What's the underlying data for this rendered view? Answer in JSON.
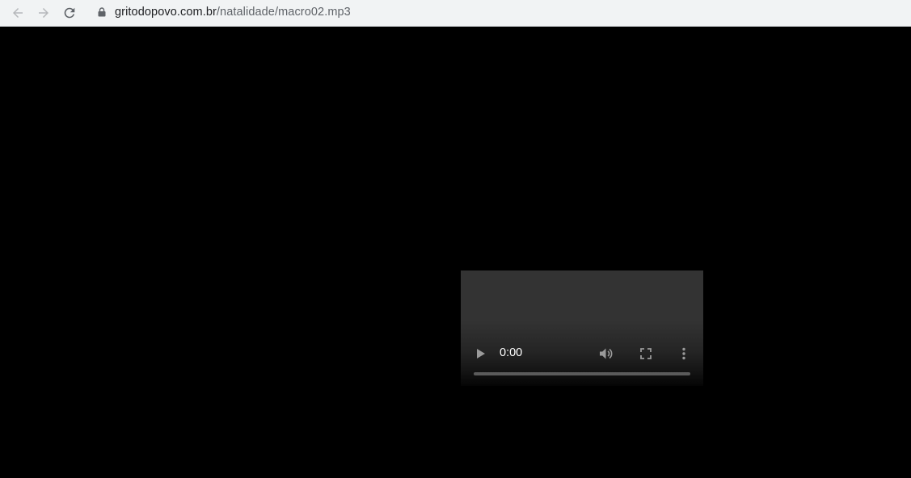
{
  "browser": {
    "url_host": "gritodopovo.com.br",
    "url_path": "/natalidade/macro02.mp3"
  },
  "media_player": {
    "current_time": "0:00",
    "progress_fraction": 0
  },
  "colors": {
    "toolbar_bg": "#f1f3f4",
    "page_bg": "#000000",
    "player_bg": "#333333"
  },
  "icons": [
    "back-arrow-icon",
    "forward-arrow-icon",
    "reload-icon",
    "lock-icon",
    "play-icon",
    "volume-icon",
    "fullscreen-icon",
    "more-vert-icon"
  ]
}
